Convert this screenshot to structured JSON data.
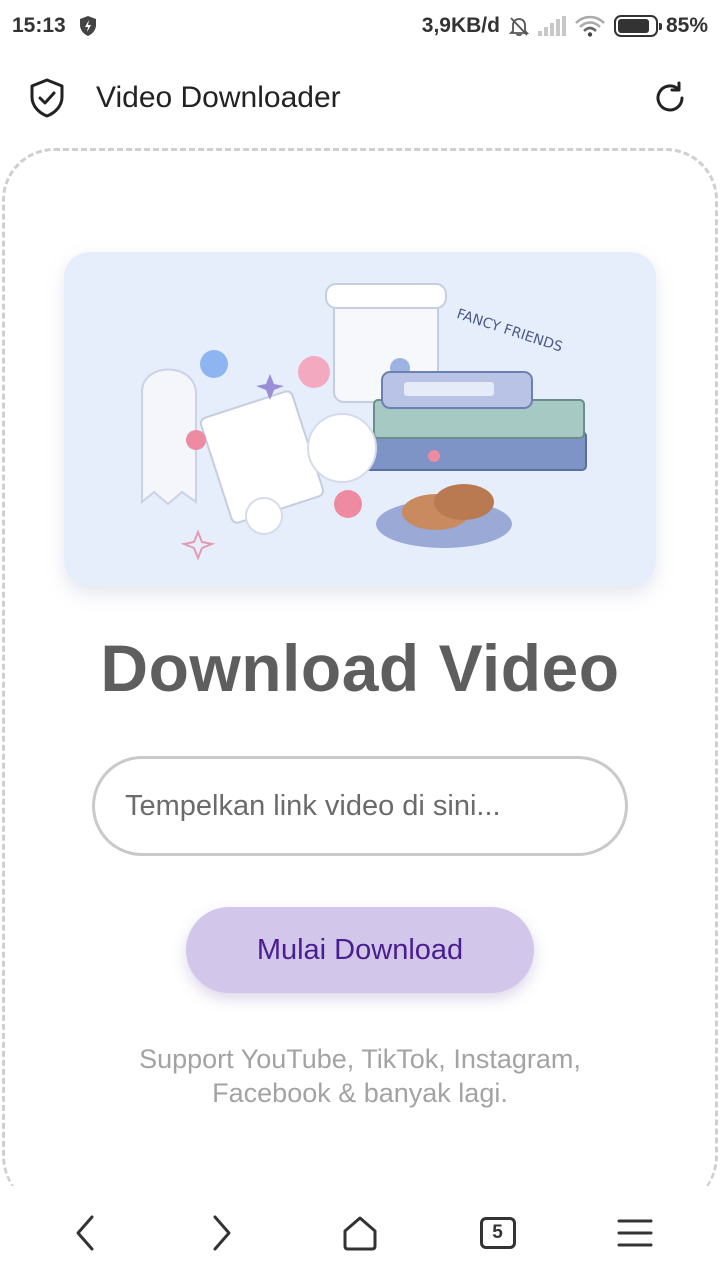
{
  "status_bar": {
    "time": "15:13",
    "network_speed": "3,9KB/d",
    "battery": "85%",
    "icons": [
      "shield-bolt-icon",
      "bell-off-icon",
      "signal-icon",
      "wifi-icon",
      "battery-icon"
    ]
  },
  "app_bar": {
    "title": "Video Downloader",
    "icons": [
      "shield-check-icon",
      "refresh-icon"
    ]
  },
  "main": {
    "hero_text": "FANCY FRIENDS",
    "headline": "Download Video",
    "url_input": {
      "placeholder": "Tempelkan link video di sini...",
      "value": ""
    },
    "start_button_label": "Mulai Download",
    "support_line1": "Support YouTube, TikTok, Instagram,",
    "support_line2": "Facebook & banyak lagi."
  },
  "bottom_nav": {
    "tab_count": "5",
    "icons": [
      "back-icon",
      "forward-icon",
      "home-icon",
      "tabs-icon",
      "menu-icon"
    ]
  },
  "colors": {
    "button_bg": "#d2c6ea",
    "button_text": "#4a1e8f",
    "headline": "#5e5e5e",
    "hero_bg": "#e6eefb"
  }
}
